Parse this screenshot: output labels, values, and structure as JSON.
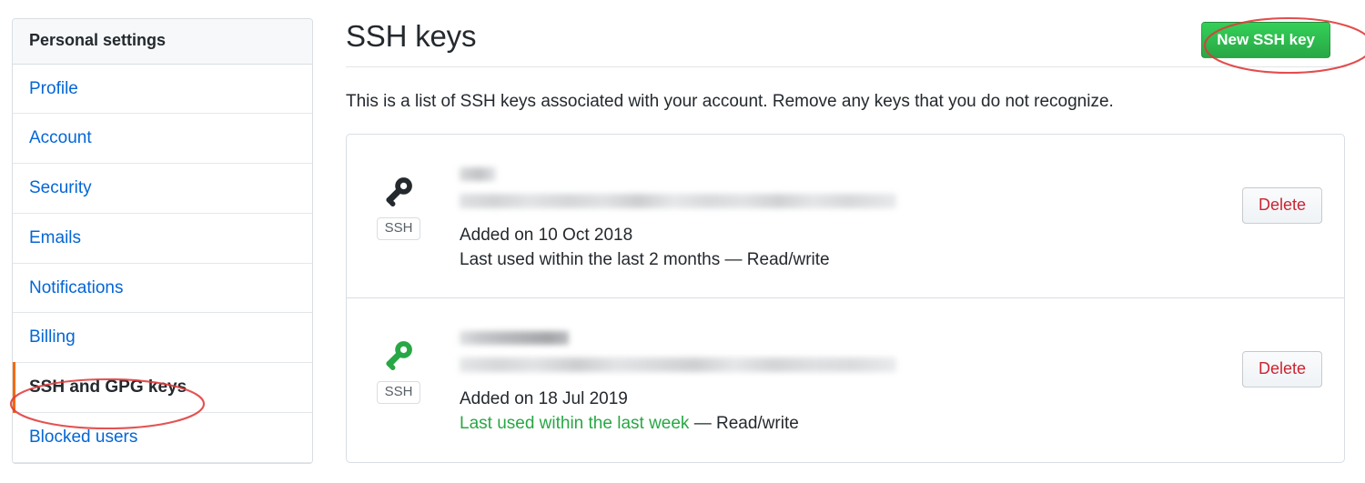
{
  "sidebar": {
    "header": "Personal settings",
    "items": [
      {
        "label": "Profile",
        "selected": false
      },
      {
        "label": "Account",
        "selected": false
      },
      {
        "label": "Security",
        "selected": false
      },
      {
        "label": "Emails",
        "selected": false
      },
      {
        "label": "Notifications",
        "selected": false
      },
      {
        "label": "Billing",
        "selected": false
      },
      {
        "label": "SSH and GPG keys",
        "selected": true
      },
      {
        "label": "Blocked users",
        "selected": false
      }
    ]
  },
  "main": {
    "title": "SSH keys",
    "new_key_label": "New SSH key",
    "description": "This is a list of SSH keys associated with your account. Remove any keys that you do not recognize."
  },
  "keys": [
    {
      "icon_color": "#24292e",
      "badge": "SSH",
      "title_redacted": true,
      "fingerprint_redacted": true,
      "added": "Added on 10 Oct 2018",
      "last_used": "Last used within the last 2 months",
      "last_used_highlight": false,
      "permission": " — Read/write",
      "delete_label": "Delete"
    },
    {
      "icon_color": "#28a745",
      "badge": "SSH",
      "title_redacted": true,
      "fingerprint_redacted": true,
      "added": "Added on 18 Jul 2019",
      "last_used": "Last used within the last week",
      "last_used_highlight": true,
      "permission": " — Read/write",
      "delete_label": "Delete"
    }
  ],
  "annotations": {
    "sidebar_ellipse": "red-ellipse-around-ssh-and-gpg-keys",
    "button_ellipse": "red-ellipse-around-new-ssh-key-button"
  },
  "colors": {
    "link": "#0366d6",
    "green": "#28a745",
    "red_annotation": "#e03a3a",
    "orange_indicator": "#f66a0a",
    "delete_red": "#cb2431"
  }
}
